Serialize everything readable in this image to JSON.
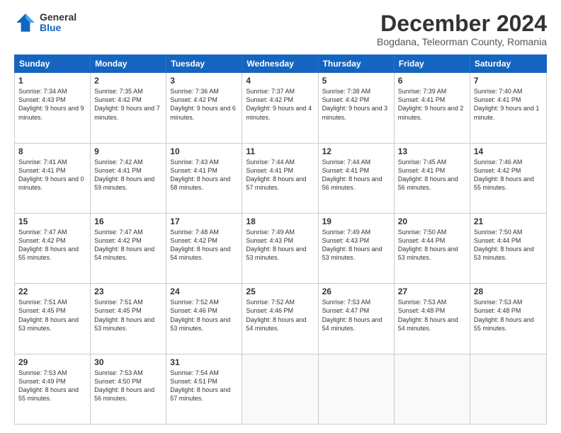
{
  "logo": {
    "general": "General",
    "blue": "Blue"
  },
  "title": "December 2024",
  "subtitle": "Bogdana, Teleorman County, Romania",
  "header_days": [
    "Sunday",
    "Monday",
    "Tuesday",
    "Wednesday",
    "Thursday",
    "Friday",
    "Saturday"
  ],
  "weeks": [
    [
      {
        "day": "1",
        "sunrise": "7:34 AM",
        "sunset": "4:43 PM",
        "daylight": "9 hours and 9 minutes."
      },
      {
        "day": "2",
        "sunrise": "7:35 AM",
        "sunset": "4:42 PM",
        "daylight": "9 hours and 7 minutes."
      },
      {
        "day": "3",
        "sunrise": "7:36 AM",
        "sunset": "4:42 PM",
        "daylight": "9 hours and 6 minutes."
      },
      {
        "day": "4",
        "sunrise": "7:37 AM",
        "sunset": "4:42 PM",
        "daylight": "9 hours and 4 minutes."
      },
      {
        "day": "5",
        "sunrise": "7:38 AM",
        "sunset": "4:42 PM",
        "daylight": "9 hours and 3 minutes."
      },
      {
        "day": "6",
        "sunrise": "7:39 AM",
        "sunset": "4:41 PM",
        "daylight": "9 hours and 2 minutes."
      },
      {
        "day": "7",
        "sunrise": "7:40 AM",
        "sunset": "4:41 PM",
        "daylight": "9 hours and 1 minute."
      }
    ],
    [
      {
        "day": "8",
        "sunrise": "7:41 AM",
        "sunset": "4:41 PM",
        "daylight": "9 hours and 0 minutes."
      },
      {
        "day": "9",
        "sunrise": "7:42 AM",
        "sunset": "4:41 PM",
        "daylight": "8 hours and 59 minutes."
      },
      {
        "day": "10",
        "sunrise": "7:43 AM",
        "sunset": "4:41 PM",
        "daylight": "8 hours and 58 minutes."
      },
      {
        "day": "11",
        "sunrise": "7:44 AM",
        "sunset": "4:41 PM",
        "daylight": "8 hours and 57 minutes."
      },
      {
        "day": "12",
        "sunrise": "7:44 AM",
        "sunset": "4:41 PM",
        "daylight": "8 hours and 56 minutes."
      },
      {
        "day": "13",
        "sunrise": "7:45 AM",
        "sunset": "4:41 PM",
        "daylight": "8 hours and 56 minutes."
      },
      {
        "day": "14",
        "sunrise": "7:46 AM",
        "sunset": "4:42 PM",
        "daylight": "8 hours and 55 minutes."
      }
    ],
    [
      {
        "day": "15",
        "sunrise": "7:47 AM",
        "sunset": "4:42 PM",
        "daylight": "8 hours and 55 minutes."
      },
      {
        "day": "16",
        "sunrise": "7:47 AM",
        "sunset": "4:42 PM",
        "daylight": "8 hours and 54 minutes."
      },
      {
        "day": "17",
        "sunrise": "7:48 AM",
        "sunset": "4:42 PM",
        "daylight": "8 hours and 54 minutes."
      },
      {
        "day": "18",
        "sunrise": "7:49 AM",
        "sunset": "4:43 PM",
        "daylight": "8 hours and 53 minutes."
      },
      {
        "day": "19",
        "sunrise": "7:49 AM",
        "sunset": "4:43 PM",
        "daylight": "8 hours and 53 minutes."
      },
      {
        "day": "20",
        "sunrise": "7:50 AM",
        "sunset": "4:44 PM",
        "daylight": "8 hours and 53 minutes."
      },
      {
        "day": "21",
        "sunrise": "7:50 AM",
        "sunset": "4:44 PM",
        "daylight": "8 hours and 53 minutes."
      }
    ],
    [
      {
        "day": "22",
        "sunrise": "7:51 AM",
        "sunset": "4:45 PM",
        "daylight": "8 hours and 53 minutes."
      },
      {
        "day": "23",
        "sunrise": "7:51 AM",
        "sunset": "4:45 PM",
        "daylight": "8 hours and 53 minutes."
      },
      {
        "day": "24",
        "sunrise": "7:52 AM",
        "sunset": "4:46 PM",
        "daylight": "8 hours and 53 minutes."
      },
      {
        "day": "25",
        "sunrise": "7:52 AM",
        "sunset": "4:46 PM",
        "daylight": "8 hours and 54 minutes."
      },
      {
        "day": "26",
        "sunrise": "7:53 AM",
        "sunset": "4:47 PM",
        "daylight": "8 hours and 54 minutes."
      },
      {
        "day": "27",
        "sunrise": "7:53 AM",
        "sunset": "4:48 PM",
        "daylight": "8 hours and 54 minutes."
      },
      {
        "day": "28",
        "sunrise": "7:53 AM",
        "sunset": "4:48 PM",
        "daylight": "8 hours and 55 minutes."
      }
    ],
    [
      {
        "day": "29",
        "sunrise": "7:53 AM",
        "sunset": "4:49 PM",
        "daylight": "8 hours and 55 minutes."
      },
      {
        "day": "30",
        "sunrise": "7:53 AM",
        "sunset": "4:50 PM",
        "daylight": "8 hours and 56 minutes."
      },
      {
        "day": "31",
        "sunrise": "7:54 AM",
        "sunset": "4:51 PM",
        "daylight": "8 hours and 57 minutes."
      },
      null,
      null,
      null,
      null
    ]
  ]
}
